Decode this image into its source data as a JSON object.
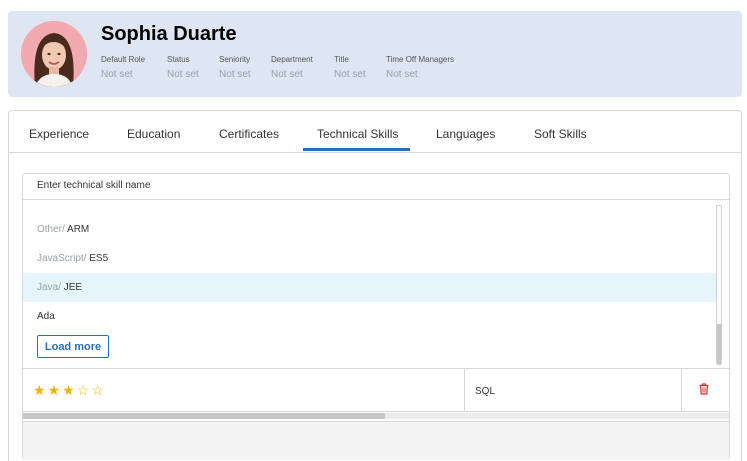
{
  "profile": {
    "name": "Sophia Duarte",
    "fields": [
      {
        "label": "Default Role",
        "value": "Not set"
      },
      {
        "label": "Status",
        "value": "Not set"
      },
      {
        "label": "Seniority",
        "value": "Not set"
      },
      {
        "label": "Department",
        "value": "Not set"
      },
      {
        "label": "Title",
        "value": "Not set"
      },
      {
        "label": "Time Off Managers",
        "value": "Not set"
      }
    ]
  },
  "tabs": [
    {
      "label": "Experience"
    },
    {
      "label": "Education"
    },
    {
      "label": "Certificates"
    },
    {
      "label": "Technical Skills",
      "active": true
    },
    {
      "label": "Languages"
    },
    {
      "label": "Soft Skills"
    }
  ],
  "search": {
    "placeholder": "Enter technical skill name"
  },
  "options": [
    {
      "category": "Other/",
      "name": "ARM"
    },
    {
      "category": "JavaScript/",
      "name": "ES5"
    },
    {
      "category": "Java/",
      "name": "JEE",
      "highlighted": true
    },
    {
      "category": "",
      "name": "Ada"
    }
  ],
  "load_more_label": "Load more",
  "skill_row": {
    "rating": 3,
    "max_rating": 5,
    "name": "SQL"
  },
  "icons": {
    "delete": "trash-icon",
    "rating": "star-icon"
  },
  "colors": {
    "accent": "#2a6ebb",
    "star": "#f0b400",
    "delete": "#d9302c",
    "header_bg": "#dde6f2",
    "highlight": "#e4f6fb"
  }
}
